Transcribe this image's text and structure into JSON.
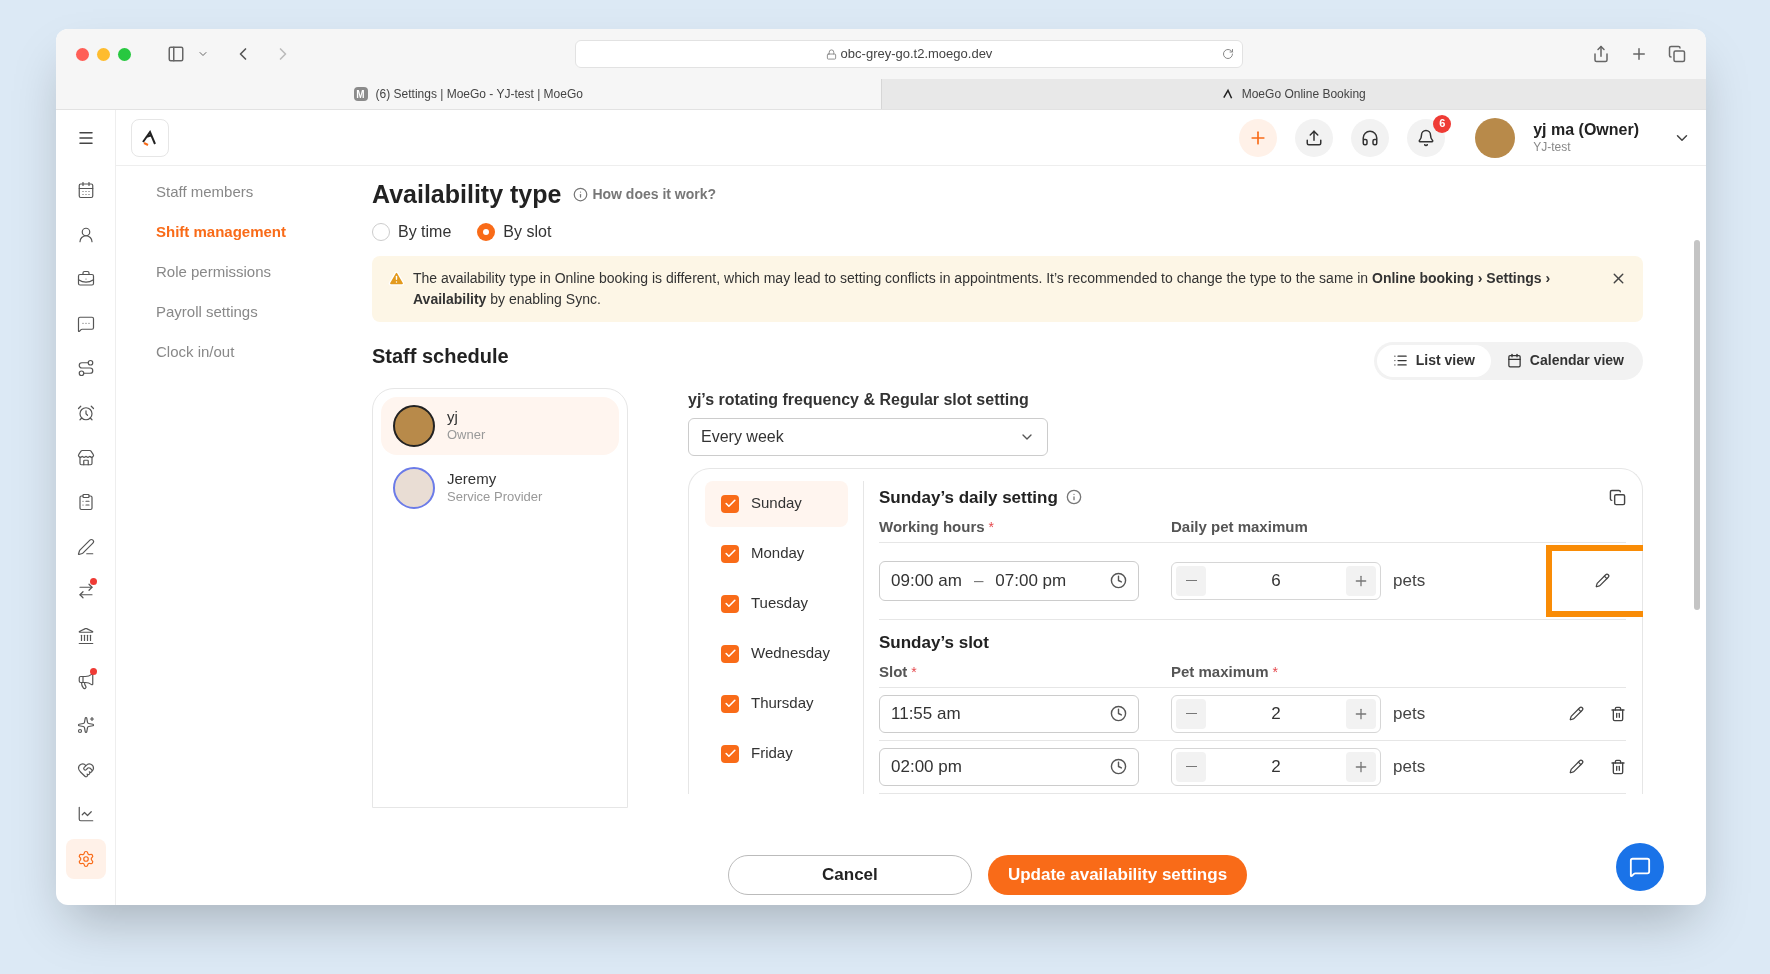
{
  "browser": {
    "url": "obc-grey-go.t2.moego.dev",
    "tabs": [
      {
        "label": "(6) Settings | MoeGo - YJ-test | MoeGo",
        "favicon": "M",
        "selected": true
      },
      {
        "label": "MoeGo Online Booking",
        "selected": false
      }
    ]
  },
  "header": {
    "notification_count": "6",
    "user": {
      "name": "yj ma (Owner)",
      "business": "YJ-test"
    }
  },
  "rail": [
    {
      "selected": false,
      "dot": false
    },
    {
      "selected": false,
      "dot": false
    },
    {
      "selected": false,
      "dot": false
    },
    {
      "selected": false,
      "dot": false
    },
    {
      "selected": false,
      "dot": false
    },
    {
      "selected": false,
      "dot": false
    },
    {
      "selected": false,
      "dot": false
    },
    {
      "selected": false,
      "dot": false
    },
    {
      "selected": false,
      "dot": false
    },
    {
      "selected": false,
      "dot": true
    },
    {
      "selected": false,
      "dot": false
    },
    {
      "selected": false,
      "dot": true
    },
    {
      "selected": false,
      "dot": false
    },
    {
      "selected": false,
      "dot": false
    },
    {
      "selected": false,
      "dot": false
    },
    {
      "selected": true,
      "dot": false
    }
  ],
  "settings_nav": [
    {
      "label": "Staff members",
      "selected": false
    },
    {
      "label": "Shift management",
      "selected": true
    },
    {
      "label": "Role permissions",
      "selected": false
    },
    {
      "label": "Payroll settings",
      "selected": false
    },
    {
      "label": "Clock in/out",
      "selected": false
    }
  ],
  "availability": {
    "title": "Availability type",
    "help": "How does it work?",
    "options": [
      {
        "label": "By time",
        "selected": false
      },
      {
        "label": "By slot",
        "selected": true
      }
    ]
  },
  "alert": {
    "text": "The availability type in Online booking is different, which may lead to setting conflicts in appointments. It’s recommended to change the type to the same in **Online booking ›** **Settings › Availability** by enabling Sync."
  },
  "staff_schedule": {
    "title": "Staff schedule",
    "views": [
      {
        "label": "List view",
        "selected": true
      },
      {
        "label": "Calendar view",
        "selected": false
      }
    ],
    "staff": [
      {
        "name": "yj",
        "role": "Owner",
        "selected": true
      },
      {
        "name": "Jeremy",
        "role": "Service Provider",
        "selected": false
      }
    ],
    "frequency_label": "yj’s rotating frequency & Regular slot setting",
    "frequency": "Every week",
    "days": [
      {
        "label": "Sunday",
        "checked": true,
        "selected": true
      },
      {
        "label": "Monday",
        "checked": true,
        "selected": false
      },
      {
        "label": "Tuesday",
        "checked": true,
        "selected": false
      },
      {
        "label": "Wednesday",
        "checked": true,
        "selected": false
      },
      {
        "label": "Thursday",
        "checked": true,
        "selected": false
      },
      {
        "label": "Friday",
        "checked": true,
        "selected": false
      }
    ],
    "daily": {
      "title": "Sunday’s daily setting",
      "hours_label": {
        "text": "Working hours",
        "required": true
      },
      "max_label": {
        "text": "Daily pet maximum",
        "required": false
      },
      "start": "09:00 am",
      "separator": "–",
      "end": "07:00 pm",
      "pet_max": "6",
      "unit": "pets",
      "edit_highlighted": true
    },
    "slot_section": {
      "title": "Sunday’s slot",
      "slot_label": {
        "text": "Slot",
        "required": true
      },
      "max_label": {
        "text": "Pet maximum",
        "required": true
      },
      "slots": [
        {
          "time": "11:55 am",
          "max": "2",
          "unit": "pets"
        },
        {
          "time": "02:00 pm",
          "max": "2",
          "unit": "pets"
        }
      ]
    },
    "required_mark": "*"
  },
  "footer": {
    "cancel": "Cancel",
    "submit": "Update availability settings"
  }
}
